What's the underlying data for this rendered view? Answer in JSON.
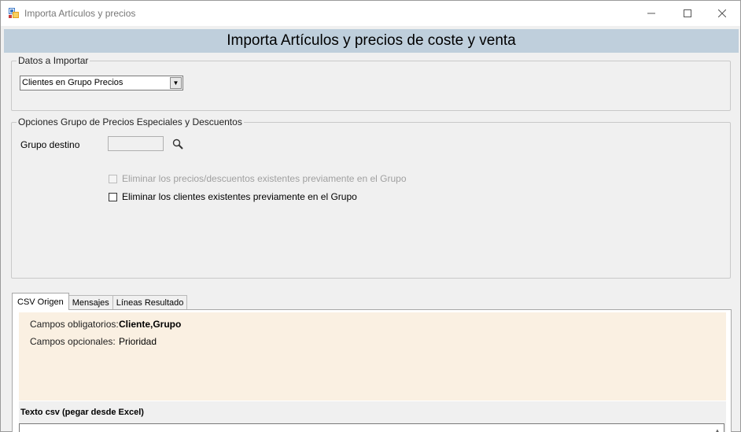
{
  "window": {
    "title": "Importa Artículos y precios",
    "min_icon": "minimize-icon",
    "max_icon": "maximize-icon",
    "close_icon": "close-icon"
  },
  "header": {
    "title": "Importa Artículos y precios de coste y venta",
    "band_color": "#bfcfdc"
  },
  "datos_importar": {
    "legend": "Datos a Importar",
    "selected": "Clientes en Grupo Precios"
  },
  "opciones": {
    "legend": "Opciones Grupo de Precios Especiales y Descuentos",
    "grupo_destino_label": "Grupo destino",
    "grupo_destino_value": "",
    "chk_eliminar_precios": {
      "label": "Eliminar los precios/descuentos existentes previamente en el Grupo",
      "checked": false,
      "enabled": false
    },
    "chk_eliminar_clientes": {
      "label": "Eliminar los clientes existentes previamente en el Grupo",
      "checked": false,
      "enabled": true
    }
  },
  "tabs": [
    {
      "label": "CSV Origen",
      "active": true
    },
    {
      "label": "Mensajes",
      "active": false
    },
    {
      "label": "Líneas Resultado",
      "active": false
    }
  ],
  "csv_origen": {
    "obligatorios_label": "Campos obligatorios:",
    "obligatorios_value": "Cliente,Grupo",
    "opcionales_label": "Campos opcionales:",
    "opcionales_value": "Prioridad",
    "info_bg_color": "#faf0e2",
    "texto_csv_label": "Texto csv (pegar desde Excel)",
    "texto_csv_value": ""
  }
}
